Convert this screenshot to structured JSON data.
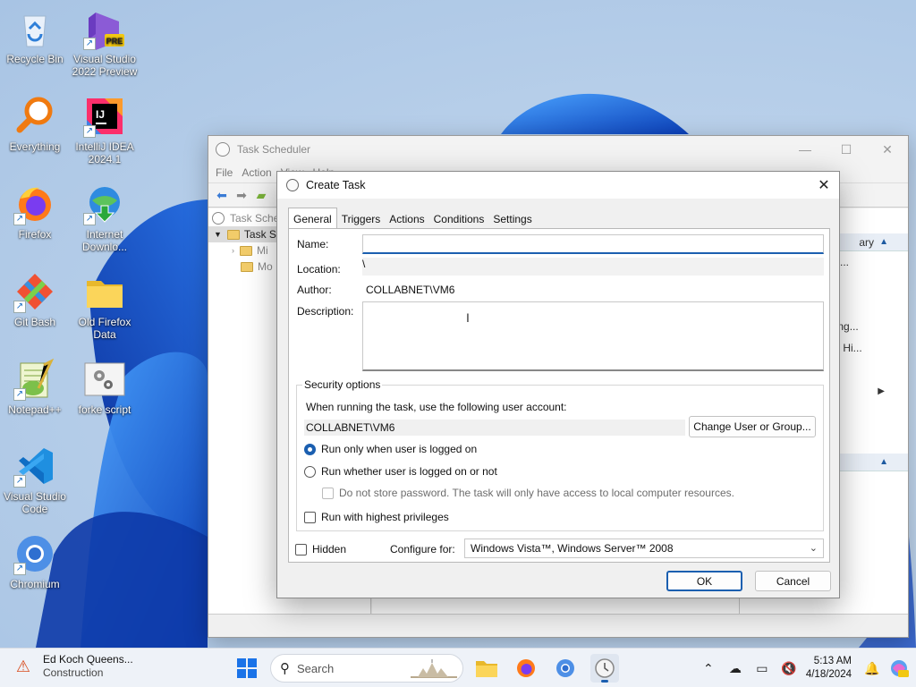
{
  "desktop": {
    "icons": [
      {
        "label": "Recycle Bin",
        "icon": "recycle-bin-icon"
      },
      {
        "label": "Visual Studio 2022 Preview",
        "icon": "visual-studio-preview-icon",
        "badge": "PRE"
      },
      {
        "label": "Everything",
        "icon": "everything-search-icon"
      },
      {
        "label": "IntelliJ IDEA 2024.1",
        "icon": "intellij-idea-icon",
        "badge": "IJ"
      },
      {
        "label": "Firefox",
        "icon": "firefox-icon"
      },
      {
        "label": "Internet Downlo...",
        "icon": "internet-download-manager-icon"
      },
      {
        "label": "Git Bash",
        "icon": "git-bash-icon"
      },
      {
        "label": "Old Firefox Data",
        "icon": "folder-icon"
      },
      {
        "label": "Notepad++",
        "icon": "notepad-plus-plus-icon"
      },
      {
        "label": "forke script",
        "icon": "script-file-icon"
      },
      {
        "label": "Visual Studio Code",
        "icon": "vscode-icon"
      },
      {
        "label": "Chromium",
        "icon": "chromium-icon"
      }
    ]
  },
  "task_scheduler": {
    "title": "Task Scheduler",
    "menu": [
      "File",
      "Action",
      "View",
      "Help"
    ],
    "tree": [
      "Task Sche",
      "Task S",
      "Mi",
      "Mo"
    ],
    "actions_header_1": "ary",
    "actions_items": [
      "sk...",
      "ning...",
      "ks Hi..."
    ]
  },
  "dialog": {
    "title": "Create Task",
    "tabs": [
      "General",
      "Triggers",
      "Actions",
      "Conditions",
      "Settings"
    ],
    "active_tab": "General",
    "name_label": "Name:",
    "name_value": "",
    "location_label": "Location:",
    "location_value": "\\",
    "author_label": "Author:",
    "author_value": "COLLABNET\\VM6",
    "description_label": "Description:",
    "description_value": "",
    "security": {
      "title": "Security options",
      "account_prompt": "When running the task, use the following user account:",
      "account": "COLLABNET\\VM6",
      "change_button": "Change User or Group...",
      "radio_logged_on": "Run only when user is logged on",
      "radio_whether": "Run whether user is logged on or not",
      "selected_radio": "logged_on",
      "no_store_password": "Do not store password.  The task will only have access to local computer resources.",
      "highest_privileges": "Run with highest privileges"
    },
    "hidden_label": "Hidden",
    "configure_label": "Configure for:",
    "configure_value": "Windows Vista™, Windows Server™ 2008",
    "ok_button": "OK",
    "cancel_button": "Cancel"
  },
  "taskbar": {
    "news_title": "Ed Koch Queens...",
    "news_subtitle": "Construction",
    "search_placeholder": "Search",
    "time": "5:13 AM",
    "date": "4/18/2024"
  },
  "colors": {
    "accent": "#1b5fb0",
    "wallpaper_blue": "#1a5fd8"
  }
}
